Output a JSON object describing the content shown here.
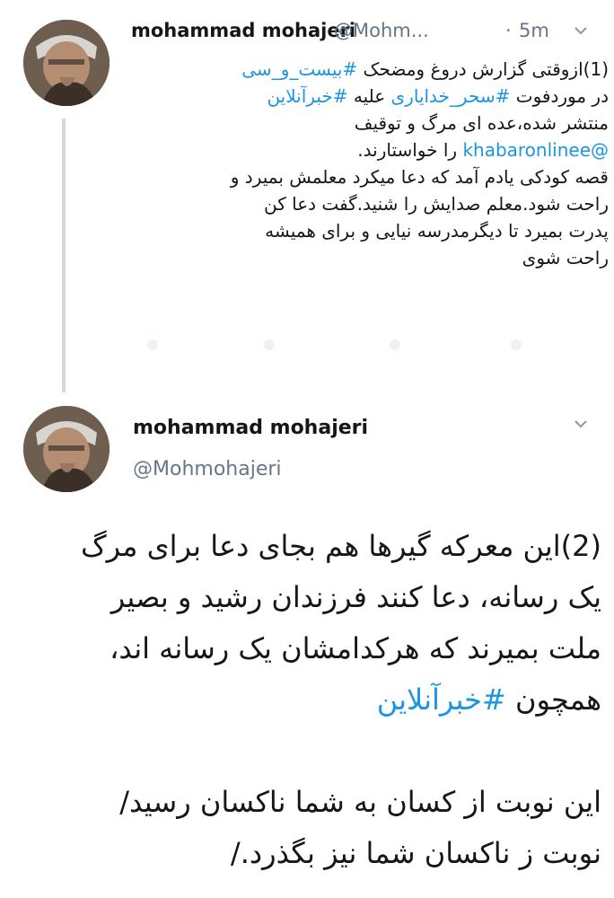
{
  "tweet1": {
    "display_name": "mohammad mohajeri",
    "handle": "@Mohm...",
    "separator": "·",
    "time": "5m",
    "lines": [
      [
        {
          "t": "(1)ازوقتی گزارش دروغ ومضحک "
        },
        {
          "t": "#بیست_و_سی",
          "link": true
        }
      ],
      [
        {
          "t": "در موردفوت "
        },
        {
          "t": "#سحر_خدایاری",
          "link": true
        },
        {
          "t": " علیه "
        },
        {
          "t": "#خبرآنلاین",
          "link": true
        }
      ],
      [
        {
          "t": "منتشر شده،عده ای مرگ و توقیف"
        }
      ],
      [
        {
          "t": "@khabaronlinee",
          "link": true
        },
        {
          "t": " را خواستارند."
        }
      ],
      [
        {
          "t": "قصه کودکی یادم آمد که دعا میکرد معلمش بمیرد و"
        }
      ],
      [
        {
          "t": "راحت شود.معلم صدایش را شنید.گفت دعا کن"
        }
      ],
      [
        {
          "t": "پدرت بمیرد تا دیگرمدرسه نیایی و برای همیشه"
        }
      ],
      [
        {
          "t": "راحت شوی"
        }
      ]
    ]
  },
  "tweet2": {
    "display_name": "mohammad mohajeri",
    "handle": "@Mohmohajeri",
    "lines": [
      [
        {
          "t": "(2)این معرکه گیرها هم بجای دعا برای مرگ"
        }
      ],
      [
        {
          "t": "یک رسانه، دعا کنند فرزندان رشید و بصیر"
        }
      ],
      [
        {
          "t": "ملت بمیرند که هرکدامشان یک رسانه اند،"
        }
      ],
      [
        {
          "t": "همچون "
        },
        {
          "t": "#خبرآنلاین",
          "link": true
        }
      ],
      [
        {
          "t": ""
        }
      ],
      [
        {
          "t": "این نوبت از کسان به شما ناکسان رسید/"
        }
      ],
      [
        {
          "t": "نوبت ز ناکسان شما نیز بگذرد./"
        }
      ]
    ]
  },
  "icons": {
    "avatar": "profile-photo",
    "chevron": "chevron-down-icon",
    "action_row": "faded-action-icons"
  },
  "colors": {
    "link": "#1b95e0",
    "secondary": "#657786",
    "thread_line": "#cfd9de"
  }
}
